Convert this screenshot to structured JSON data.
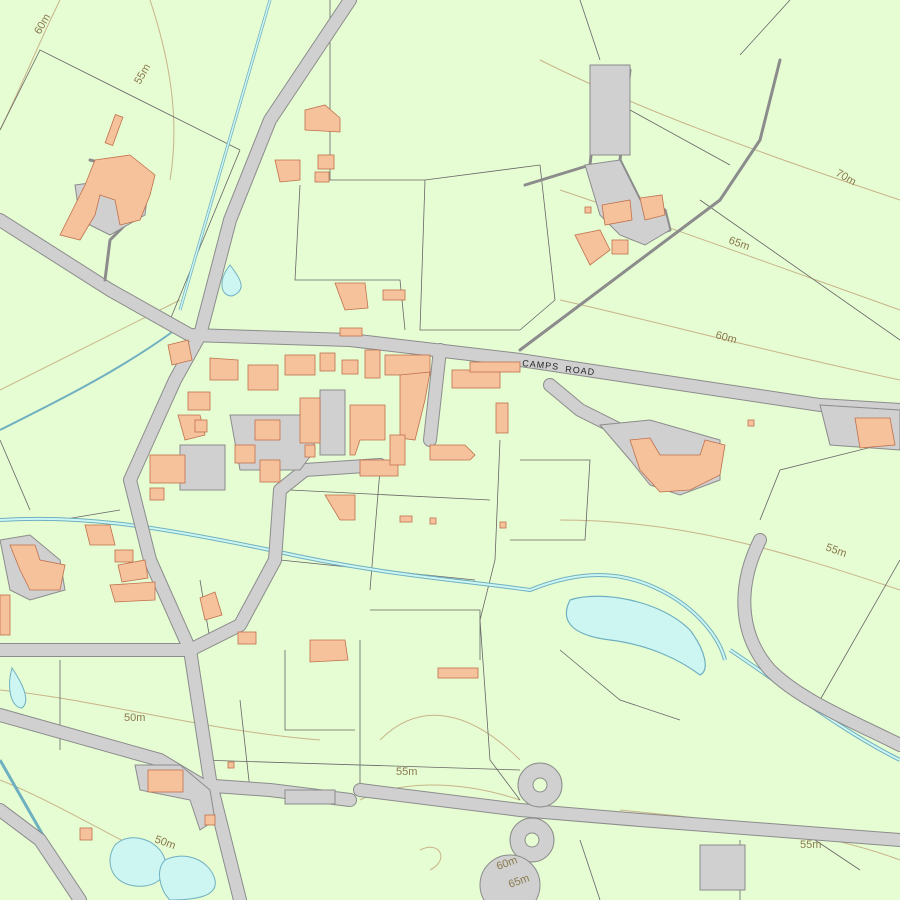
{
  "map": {
    "colors": {
      "background": "#e6fcd3",
      "road_fill": "#d0d0d0",
      "road_edge": "#8c8c8c",
      "building_fill": "#f5c29c",
      "building_edge": "#c0704c",
      "water_fill": "#cdf6f2",
      "water_edge": "#6fb0c0",
      "contour": "#c8b488",
      "boundary": "#666666",
      "label": "#8b7a4e"
    },
    "road_labels": {
      "camps": "CAMPS",
      "road": "ROAD"
    },
    "contour_labels": {
      "c60_nw": "60m",
      "c55_n": "55m",
      "c70_ne": "70m",
      "c65_ne": "65m",
      "c60_e": "60m",
      "c55_e": "55m",
      "c50_w": "50m",
      "c55_s": "55m",
      "c50_sw": "50m",
      "c60_s": "60m",
      "c65_s": "65m",
      "c55_se": "55m"
    }
  }
}
